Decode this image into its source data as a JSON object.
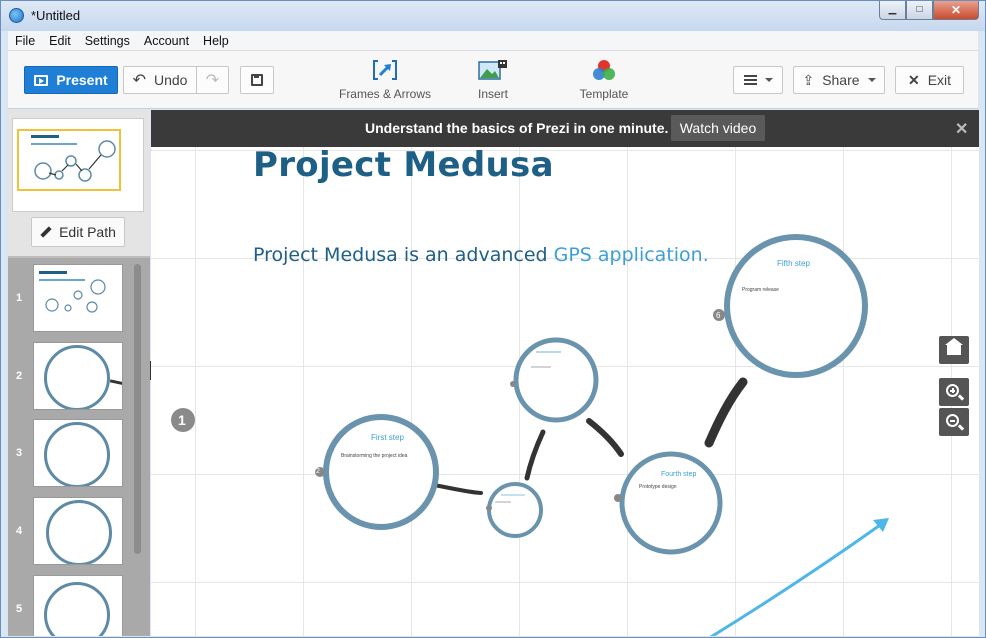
{
  "window": {
    "title": "*Untitled"
  },
  "menu": [
    "File",
    "Edit",
    "Settings",
    "Account",
    "Help"
  ],
  "toolbar": {
    "present_label": "Present",
    "undo_label": "Undo",
    "frames_label": "Frames & Arrows",
    "insert_label": "Insert",
    "template_label": "Template",
    "share_label": "Share",
    "exit_label": "Exit"
  },
  "sidebar": {
    "edit_path_label": "Edit Path",
    "thumbnails": [
      {
        "number": "1"
      },
      {
        "number": "2"
      },
      {
        "number": "3"
      },
      {
        "number": "4"
      },
      {
        "number": "5"
      }
    ]
  },
  "banner": {
    "text": "Understand the basics of Prezi in one minute.",
    "button_label": "Watch video"
  },
  "canvas": {
    "title": "Project Medusa",
    "subtitle_plain": "Project Medusa is an advanced ",
    "subtitle_highlight": "GPS application.",
    "overview_marker": "1",
    "circles": [
      {
        "step": "2",
        "title": "First step",
        "body": "Brainstorming the project idea"
      },
      {
        "step": "3",
        "title": "",
        "body": ""
      },
      {
        "step": "4",
        "title": "",
        "body": ""
      },
      {
        "step": "5",
        "title": "Fourth step",
        "body": "Prototype design"
      },
      {
        "step": "6",
        "title": "Fifth step",
        "body": "Program release"
      }
    ]
  },
  "colors": {
    "accent": "#1f7fd6",
    "title": "#1d5f85",
    "highlight": "#3d9fd6",
    "circle": "#5d8aa5"
  }
}
